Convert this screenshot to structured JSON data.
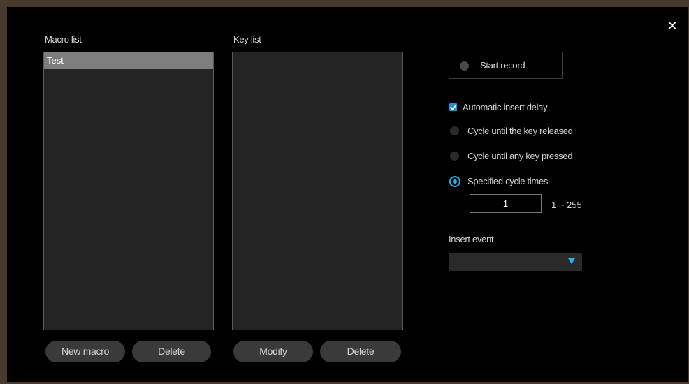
{
  "window": {
    "close_glyph": "✕"
  },
  "macro_list": {
    "label": "Macro list",
    "items": [
      "Test"
    ],
    "selected_index": 0,
    "new_button": "New macro",
    "delete_button": "Delete"
  },
  "key_list": {
    "label": "Key list",
    "items": [],
    "modify_button": "Modify",
    "delete_button": "Delete"
  },
  "record": {
    "label": "Start record"
  },
  "options": {
    "auto_delay": {
      "label": "Automatic insert delay",
      "checked": true
    },
    "cycle_release": {
      "label": "Cycle until the key released",
      "selected": false
    },
    "cycle_any_key": {
      "label": "Cycle until any key pressed",
      "selected": false
    },
    "cycle_times": {
      "label": "Specified cycle times",
      "selected": true
    },
    "cycle_count": "1",
    "cycle_range": "1 ~ 255"
  },
  "insert_event": {
    "label": "Insert event",
    "value": ""
  },
  "colors": {
    "accent": "#24b4f0",
    "checkbox": "#1f8fd8",
    "background": "#000000",
    "frame": "#4a3a2e"
  }
}
